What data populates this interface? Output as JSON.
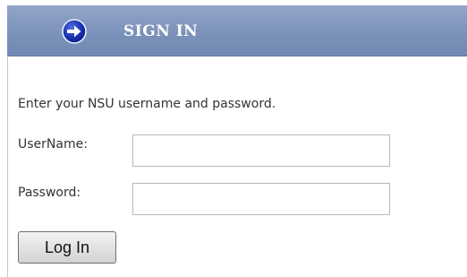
{
  "header": {
    "title": "SIGN IN",
    "icon": "arrow-right-circle-icon",
    "background_color": "#7b92ba"
  },
  "form": {
    "instruction": "Enter your NSU username and password.",
    "username_label": "UserName:",
    "username_value": "",
    "password_label": "Password:",
    "password_value": "",
    "submit_label": "Log In"
  }
}
